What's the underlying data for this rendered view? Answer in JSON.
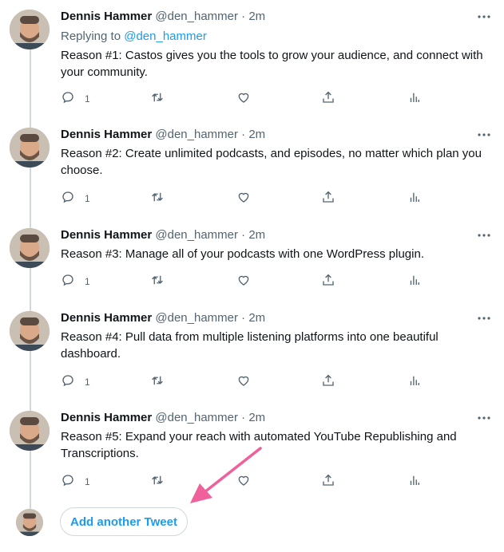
{
  "tweets": [
    {
      "name": "Dennis Hammer",
      "handle": "@den_hammer · 2m",
      "replying_prefix": "Replying to",
      "replying_handle": "@den_hammer",
      "text": "Reason #1: Castos gives you the tools to grow your audience, and connect with your community.",
      "reply_count": "1"
    },
    {
      "name": "Dennis Hammer",
      "handle": "@den_hammer · 2m",
      "text": "Reason #2: Create unlimited podcasts, and episodes, no matter which plan you choose.",
      "reply_count": "1"
    },
    {
      "name": "Dennis Hammer",
      "handle": "@den_hammer · 2m",
      "text": "Reason #3: Manage all of your podcasts with one WordPress plugin.",
      "reply_count": "1"
    },
    {
      "name": "Dennis Hammer",
      "handle": "@den_hammer · 2m",
      "text": "Reason #4: Pull data from multiple listening platforms into one beautiful dashboard.",
      "reply_count": "1"
    },
    {
      "name": "Dennis Hammer",
      "handle": "@den_hammer · 2m",
      "text": "Reason #5: Expand your reach with automated YouTube Republishing and Transcriptions.",
      "reply_count": "1"
    }
  ],
  "add_tweet_label": "Add another Tweet",
  "colors": {
    "accent": "#1d9bf0",
    "muted": "#536471",
    "text": "#0f1419",
    "thread_line": "#cfd9de",
    "annotation_arrow": "#f0609a"
  },
  "icons": [
    "more-icon",
    "reply-icon",
    "retweet-icon",
    "like-icon",
    "share-icon",
    "analytics-icon",
    "avatar"
  ]
}
